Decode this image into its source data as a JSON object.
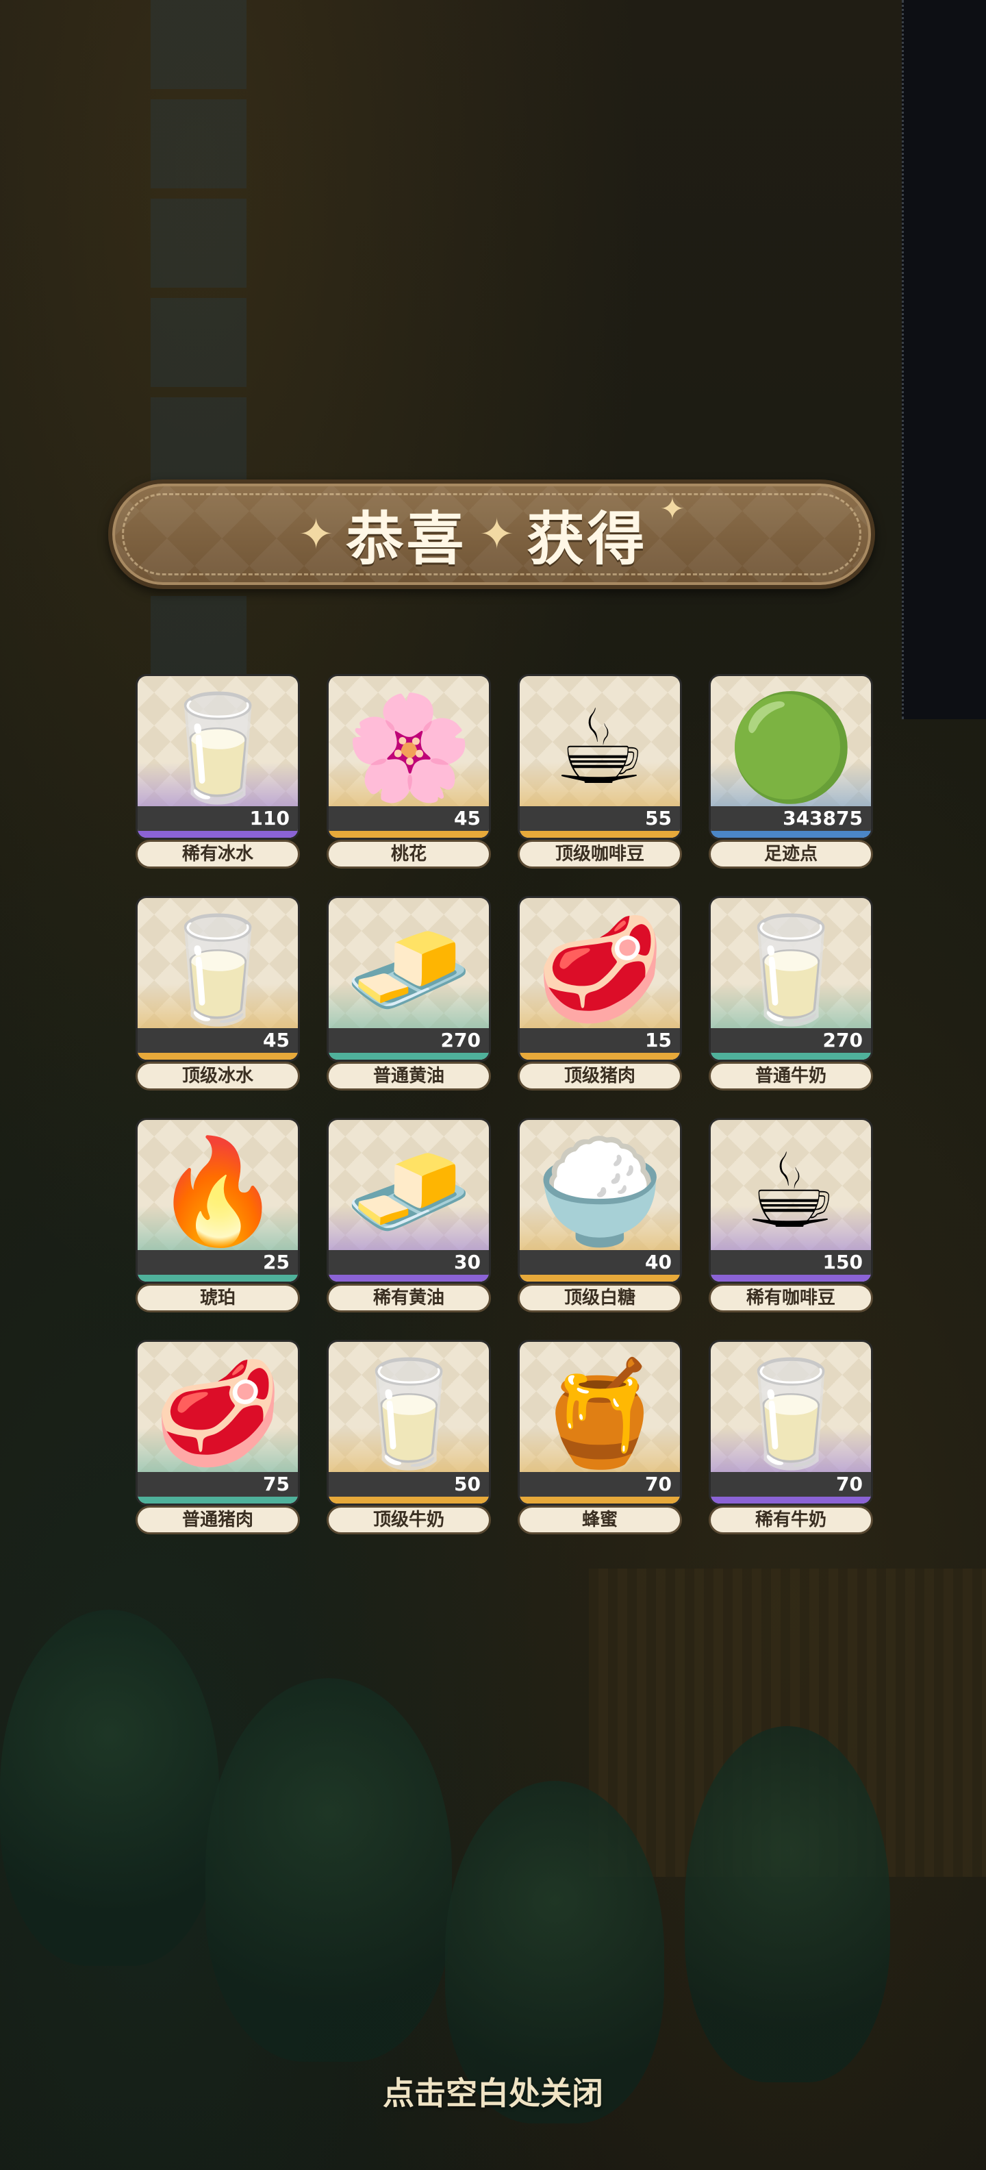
{
  "title": "恭喜获得",
  "title_left": "恭喜",
  "title_right": "获得",
  "close_hint": "点击空白处关闭",
  "items": [
    {
      "name": "稀有冰水",
      "qty": "110",
      "icon": "ice-water-icon",
      "glyph": "🥛",
      "rarity": "purple"
    },
    {
      "name": "桃花",
      "qty": "45",
      "icon": "peach-blossom-icon",
      "glyph": "🌸",
      "rarity": "gold"
    },
    {
      "name": "顶级咖啡豆",
      "qty": "55",
      "icon": "coffee-bean-bag-icon",
      "glyph": "☕",
      "rarity": "gold"
    },
    {
      "name": "足迹点",
      "qty": "343875",
      "icon": "footprint-orb-icon",
      "glyph": "🟢",
      "rarity": "blue"
    },
    {
      "name": "顶级冰水",
      "qty": "45",
      "icon": "ice-water-icon",
      "glyph": "🥛",
      "rarity": "gold"
    },
    {
      "name": "普通黄油",
      "qty": "270",
      "icon": "butter-icon",
      "glyph": "🧈",
      "rarity": "teal"
    },
    {
      "name": "顶级猪肉",
      "qty": "15",
      "icon": "pork-icon",
      "glyph": "🥩",
      "rarity": "gold"
    },
    {
      "name": "普通牛奶",
      "qty": "270",
      "icon": "milk-carton-icon",
      "glyph": "🥛",
      "rarity": "teal"
    },
    {
      "name": "琥珀",
      "qty": "25",
      "icon": "amber-icon",
      "glyph": "🔥",
      "rarity": "teal"
    },
    {
      "name": "稀有黄油",
      "qty": "30",
      "icon": "butter-icon",
      "glyph": "🧈",
      "rarity": "purple"
    },
    {
      "name": "顶级白糖",
      "qty": "40",
      "icon": "sugar-icon",
      "glyph": "🍚",
      "rarity": "gold"
    },
    {
      "name": "稀有咖啡豆",
      "qty": "150",
      "icon": "coffee-bean-bag-icon",
      "glyph": "☕",
      "rarity": "purple"
    },
    {
      "name": "普通猪肉",
      "qty": "75",
      "icon": "pork-icon",
      "glyph": "🥩",
      "rarity": "teal"
    },
    {
      "name": "顶级牛奶",
      "qty": "50",
      "icon": "milk-carton-icon",
      "glyph": "🥛",
      "rarity": "gold"
    },
    {
      "name": "蜂蜜",
      "qty": "70",
      "icon": "honey-jar-icon",
      "glyph": "🍯",
      "rarity": "gold"
    },
    {
      "name": "稀有牛奶",
      "qty": "70",
      "icon": "milk-carton-icon",
      "glyph": "🥛",
      "rarity": "purple"
    }
  ],
  "colors": {
    "purple": "#8b63d6",
    "gold": "#e7a93a",
    "teal": "#4fb19b",
    "blue": "#4b86c7",
    "banner": "#7f6242"
  }
}
